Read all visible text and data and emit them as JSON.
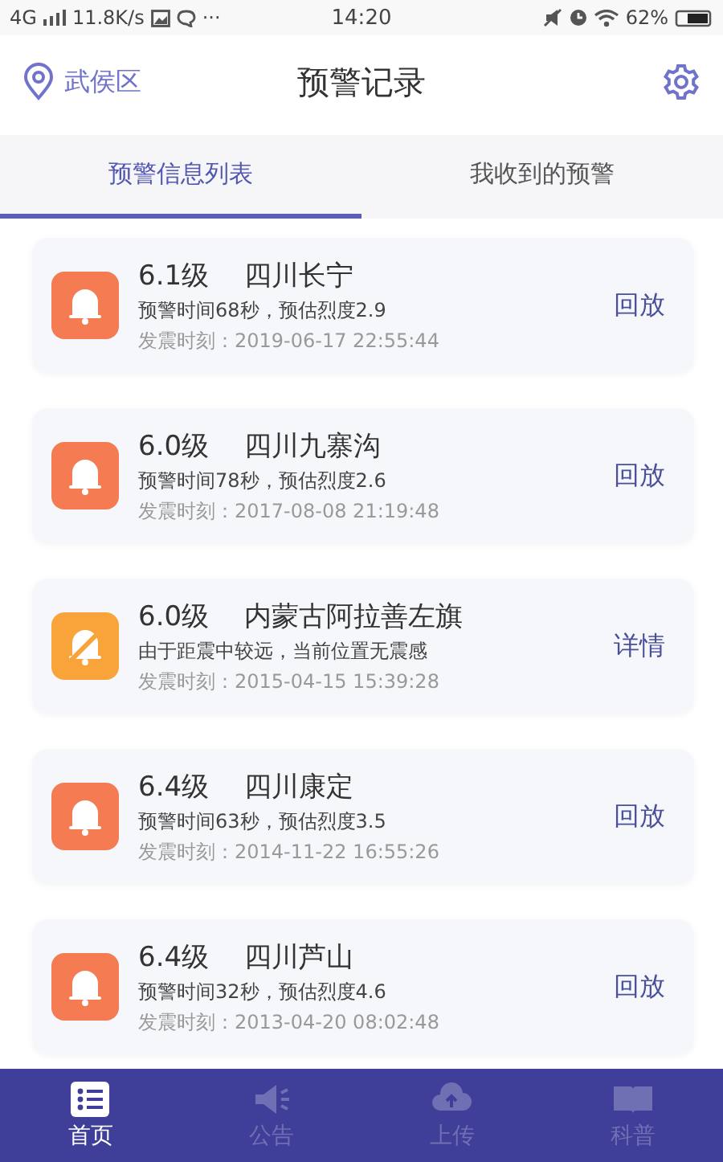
{
  "status_bar": {
    "network": "4G",
    "speed": "11.8K/s",
    "more": "···",
    "time": "14:20",
    "battery": "62%"
  },
  "header": {
    "location": "武侯区",
    "title": "预警记录"
  },
  "tabs": [
    {
      "label": "预警信息列表",
      "selected": true
    },
    {
      "label": "我收到的预警",
      "selected": false
    }
  ],
  "records": [
    {
      "magnitude": "6.1级",
      "place": "四川长宁",
      "detail": "预警时间68秒，预估烈度2.9",
      "time": "发震时刻：2019-06-17 22:55:44",
      "action": "回放",
      "kind": "alert",
      "color": "#f47b52"
    },
    {
      "magnitude": "6.0级",
      "place": "四川九寨沟",
      "detail": "预警时间78秒，预估烈度2.6",
      "time": "发震时刻：2017-08-08 21:19:48",
      "action": "回放",
      "kind": "alert",
      "color": "#f47b52"
    },
    {
      "magnitude": "6.0级",
      "place": "内蒙古阿拉善左旗",
      "detail": "由于距震中较远，当前位置无震感",
      "time": "发震时刻：2015-04-15 15:39:28",
      "action": "详情",
      "kind": "muted",
      "color": "#f8a43a"
    },
    {
      "magnitude": "6.4级",
      "place": "四川康定",
      "detail": "预警时间63秒，预估烈度3.5",
      "time": "发震时刻：2014-11-22 16:55:26",
      "action": "回放",
      "kind": "alert",
      "color": "#f47b52"
    },
    {
      "magnitude": "6.4级",
      "place": "四川芦山",
      "detail": "预警时间32秒，预估烈度4.6",
      "time": "发震时刻：2013-04-20 08:02:48",
      "action": "回放",
      "kind": "alert",
      "color": "#f47b52"
    }
  ],
  "bottom_nav": [
    {
      "label": "首页",
      "kind": "list",
      "selected": true
    },
    {
      "label": "公告",
      "kind": "megaphone",
      "selected": false
    },
    {
      "label": "上传",
      "kind": "upload",
      "selected": false
    },
    {
      "label": "科普",
      "kind": "book",
      "selected": false
    }
  ]
}
